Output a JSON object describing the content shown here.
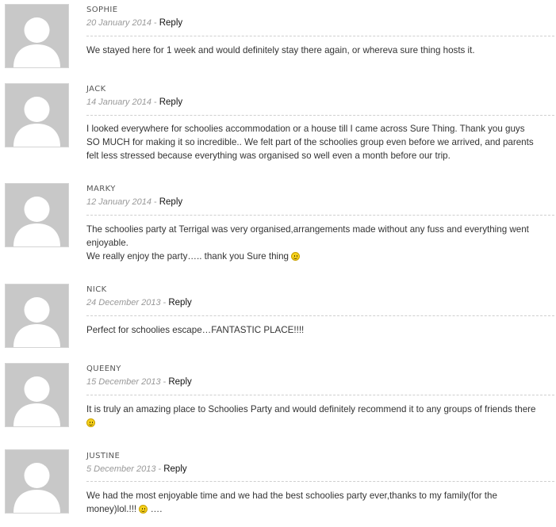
{
  "reply_label": "Reply",
  "separator": " - ",
  "comments": [
    {
      "author": "SOPHIE",
      "date": "20 January 2014",
      "lines": [
        "We stayed here for 1 week and would definitely stay there again, or whereva sure thing hosts it."
      ]
    },
    {
      "author": "JACK",
      "date": "14 January 2014",
      "lines": [
        "I looked everywhere for schoolies accommodation or a house till I came across Sure Thing. Thank you guys",
        "SO MUCH for making it so incredible.. We felt part of the schoolies group even before we arrived, and parents",
        "felt less stressed because everything was organised so well even a month before our trip."
      ]
    },
    {
      "author": "MARKY",
      "date": "12 January 2014",
      "lines": [
        "The schoolies party at Terrigal was very organised,arrangements made without any fuss and everything went",
        "enjoyable.",
        "We really enjoy the party….. thank you Sure thing"
      ]
    },
    {
      "author": "NICK",
      "date": "24 December 2013",
      "lines": [
        "Perfect for schoolies escape…FANTASTIC PLACE!!!!"
      ]
    },
    {
      "author": "QUEENY",
      "date": "15 December 2013",
      "lines": [
        "It is truly an amazing place to Schoolies Party and would definitely recommend it to any groups of friends there"
      ]
    },
    {
      "author": "JUSTINE",
      "date": "5 December 2013",
      "lines": [
        "We had the most enjoyable time and we had the best schoolies party ever,thanks to my family(for the",
        "money)lol.!!!",
        "…."
      ]
    }
  ]
}
